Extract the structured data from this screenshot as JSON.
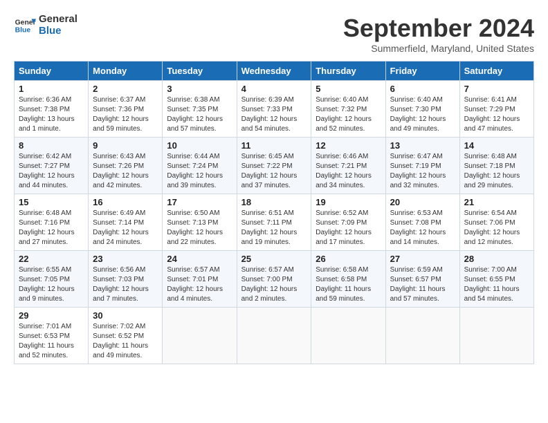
{
  "logo": {
    "line1": "General",
    "line2": "Blue"
  },
  "title": "September 2024",
  "location": "Summerfield, Maryland, United States",
  "days_of_week": [
    "Sunday",
    "Monday",
    "Tuesday",
    "Wednesday",
    "Thursday",
    "Friday",
    "Saturday"
  ],
  "weeks": [
    [
      {
        "day": "1",
        "info": "Sunrise: 6:36 AM\nSunset: 7:38 PM\nDaylight: 13 hours\nand 1 minute."
      },
      {
        "day": "2",
        "info": "Sunrise: 6:37 AM\nSunset: 7:36 PM\nDaylight: 12 hours\nand 59 minutes."
      },
      {
        "day": "3",
        "info": "Sunrise: 6:38 AM\nSunset: 7:35 PM\nDaylight: 12 hours\nand 57 minutes."
      },
      {
        "day": "4",
        "info": "Sunrise: 6:39 AM\nSunset: 7:33 PM\nDaylight: 12 hours\nand 54 minutes."
      },
      {
        "day": "5",
        "info": "Sunrise: 6:40 AM\nSunset: 7:32 PM\nDaylight: 12 hours\nand 52 minutes."
      },
      {
        "day": "6",
        "info": "Sunrise: 6:40 AM\nSunset: 7:30 PM\nDaylight: 12 hours\nand 49 minutes."
      },
      {
        "day": "7",
        "info": "Sunrise: 6:41 AM\nSunset: 7:29 PM\nDaylight: 12 hours\nand 47 minutes."
      }
    ],
    [
      {
        "day": "8",
        "info": "Sunrise: 6:42 AM\nSunset: 7:27 PM\nDaylight: 12 hours\nand 44 minutes."
      },
      {
        "day": "9",
        "info": "Sunrise: 6:43 AM\nSunset: 7:26 PM\nDaylight: 12 hours\nand 42 minutes."
      },
      {
        "day": "10",
        "info": "Sunrise: 6:44 AM\nSunset: 7:24 PM\nDaylight: 12 hours\nand 39 minutes."
      },
      {
        "day": "11",
        "info": "Sunrise: 6:45 AM\nSunset: 7:22 PM\nDaylight: 12 hours\nand 37 minutes."
      },
      {
        "day": "12",
        "info": "Sunrise: 6:46 AM\nSunset: 7:21 PM\nDaylight: 12 hours\nand 34 minutes."
      },
      {
        "day": "13",
        "info": "Sunrise: 6:47 AM\nSunset: 7:19 PM\nDaylight: 12 hours\nand 32 minutes."
      },
      {
        "day": "14",
        "info": "Sunrise: 6:48 AM\nSunset: 7:18 PM\nDaylight: 12 hours\nand 29 minutes."
      }
    ],
    [
      {
        "day": "15",
        "info": "Sunrise: 6:48 AM\nSunset: 7:16 PM\nDaylight: 12 hours\nand 27 minutes."
      },
      {
        "day": "16",
        "info": "Sunrise: 6:49 AM\nSunset: 7:14 PM\nDaylight: 12 hours\nand 24 minutes."
      },
      {
        "day": "17",
        "info": "Sunrise: 6:50 AM\nSunset: 7:13 PM\nDaylight: 12 hours\nand 22 minutes."
      },
      {
        "day": "18",
        "info": "Sunrise: 6:51 AM\nSunset: 7:11 PM\nDaylight: 12 hours\nand 19 minutes."
      },
      {
        "day": "19",
        "info": "Sunrise: 6:52 AM\nSunset: 7:09 PM\nDaylight: 12 hours\nand 17 minutes."
      },
      {
        "day": "20",
        "info": "Sunrise: 6:53 AM\nSunset: 7:08 PM\nDaylight: 12 hours\nand 14 minutes."
      },
      {
        "day": "21",
        "info": "Sunrise: 6:54 AM\nSunset: 7:06 PM\nDaylight: 12 hours\nand 12 minutes."
      }
    ],
    [
      {
        "day": "22",
        "info": "Sunrise: 6:55 AM\nSunset: 7:05 PM\nDaylight: 12 hours\nand 9 minutes."
      },
      {
        "day": "23",
        "info": "Sunrise: 6:56 AM\nSunset: 7:03 PM\nDaylight: 12 hours\nand 7 minutes."
      },
      {
        "day": "24",
        "info": "Sunrise: 6:57 AM\nSunset: 7:01 PM\nDaylight: 12 hours\nand 4 minutes."
      },
      {
        "day": "25",
        "info": "Sunrise: 6:57 AM\nSunset: 7:00 PM\nDaylight: 12 hours\nand 2 minutes."
      },
      {
        "day": "26",
        "info": "Sunrise: 6:58 AM\nSunset: 6:58 PM\nDaylight: 11 hours\nand 59 minutes."
      },
      {
        "day": "27",
        "info": "Sunrise: 6:59 AM\nSunset: 6:57 PM\nDaylight: 11 hours\nand 57 minutes."
      },
      {
        "day": "28",
        "info": "Sunrise: 7:00 AM\nSunset: 6:55 PM\nDaylight: 11 hours\nand 54 minutes."
      }
    ],
    [
      {
        "day": "29",
        "info": "Sunrise: 7:01 AM\nSunset: 6:53 PM\nDaylight: 11 hours\nand 52 minutes."
      },
      {
        "day": "30",
        "info": "Sunrise: 7:02 AM\nSunset: 6:52 PM\nDaylight: 11 hours\nand 49 minutes."
      },
      {
        "day": "",
        "info": ""
      },
      {
        "day": "",
        "info": ""
      },
      {
        "day": "",
        "info": ""
      },
      {
        "day": "",
        "info": ""
      },
      {
        "day": "",
        "info": ""
      }
    ]
  ]
}
